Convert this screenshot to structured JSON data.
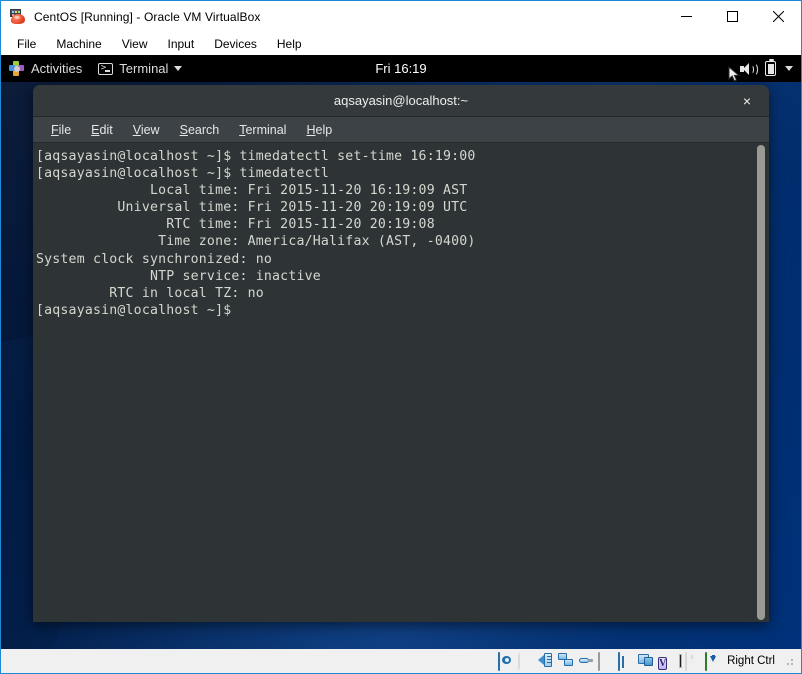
{
  "window": {
    "title": "CentOS [Running] - Oracle VM VirtualBox",
    "icon": "virtualbox-vm-icon",
    "controls": {
      "minimize": "minimize-icon",
      "maximize": "maximize-icon",
      "close": "close-icon"
    }
  },
  "vbox_menu": {
    "items": [
      {
        "label": "File"
      },
      {
        "label": "Machine"
      },
      {
        "label": "View"
      },
      {
        "label": "Input"
      },
      {
        "label": "Devices"
      },
      {
        "label": "Help"
      }
    ]
  },
  "gnome_top_bar": {
    "activities_label": "Activities",
    "activities_icon": "centos-pinwheel-icon",
    "app_menu_label": "Terminal",
    "app_menu_icon": "terminal-icon",
    "app_menu_caret": "chevron-down-icon",
    "clock": "Fri 16:19",
    "tray": {
      "volume_icon": "volume-icon",
      "battery_icon": "battery-icon",
      "caret_icon": "chevron-down-icon",
      "cursor_icon": "mouse-pointer-icon"
    }
  },
  "terminal": {
    "title": "aqsayasin@localhost:~",
    "close_label": "×",
    "menu": [
      {
        "label": "File",
        "mnemonic": "F"
      },
      {
        "label": "Edit",
        "mnemonic": "E"
      },
      {
        "label": "View",
        "mnemonic": "V"
      },
      {
        "label": "Search",
        "mnemonic": "S"
      },
      {
        "label": "Terminal",
        "mnemonic": "T"
      },
      {
        "label": "Help",
        "mnemonic": "H"
      }
    ],
    "content": "[aqsayasin@localhost ~]$ timedatectl set-time 16:19:00\n[aqsayasin@localhost ~]$ timedatectl\n              Local time: Fri 2015-11-20 16:19:09 AST\n          Universal time: Fri 2015-11-20 20:19:09 UTC\n                RTC time: Fri 2015-11-20 20:19:08\n               Time zone: America/Halifax (AST, -0400)\nSystem clock synchronized: no\n              NTP service: inactive\n         RTC in local TZ: no\n[aqsayasin@localhost ~]$",
    "lines": [
      "[aqsayasin@localhost ~]$ timedatectl set-time 16:19:00",
      "[aqsayasin@localhost ~]$ timedatectl",
      "              Local time: Fri 2015-11-20 16:19:09 AST",
      "          Universal time: Fri 2015-11-20 20:19:09 UTC",
      "                RTC time: Fri 2015-11-20 20:19:08",
      "               Time zone: America/Halifax (AST, -0400)",
      "System clock synchronized: no",
      "              NTP service: inactive",
      "         RTC in local TZ: no",
      "[aqsayasin@localhost ~]$"
    ],
    "colors": {
      "background": "#2e3436",
      "foreground": "#d3d7cf",
      "titlebar": "#34393b",
      "menubar": "#3c4245"
    }
  },
  "status_bar": {
    "host_key_label": "Right Ctrl",
    "icons": [
      {
        "name": "hard-disk-icon",
        "state": "active"
      },
      {
        "name": "optical-disk-icon",
        "state": "inactive"
      },
      {
        "name": "audio-icon",
        "state": "active"
      },
      {
        "name": "network-icon",
        "state": "active"
      },
      {
        "name": "usb-icon",
        "state": "active"
      },
      {
        "name": "shared-folders-icon",
        "state": "active"
      },
      {
        "name": "display-icon",
        "state": "active"
      },
      {
        "name": "recording-icon",
        "state": "active"
      },
      {
        "name": "virtualbox-features-icon",
        "state": "active"
      },
      {
        "name": "mouse-integration-icon",
        "state": "inactive"
      },
      {
        "name": "host-key-icon",
        "state": "active"
      }
    ],
    "resize_grip": "resize-grip-icon"
  },
  "colors": {
    "accent": "#1c8ad4",
    "desktop_blue": "#012a66",
    "statusbar_bg": "#f0f0f0"
  }
}
